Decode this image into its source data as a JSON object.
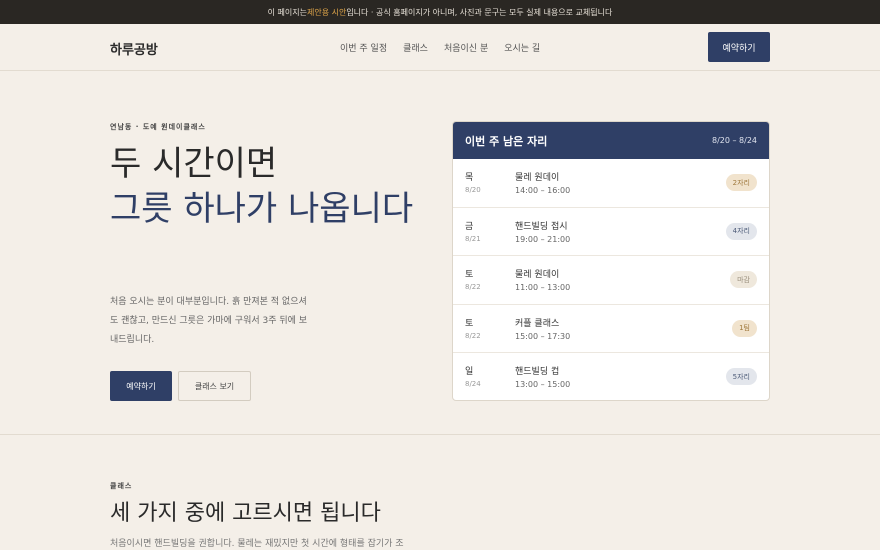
{
  "notice": {
    "before": "이 페이지는 ",
    "highlight": "제안용 시안",
    "after": "입니다 · 공식 홈페이지가 아니며, 사진과 문구는 모두 실제 내용으로 교체됩니다"
  },
  "header": {
    "logo": "하루공방",
    "nav": [
      "이번 주 일정",
      "클래스",
      "처음이신 분",
      "오시는 길"
    ],
    "cta": "예약하기"
  },
  "hero": {
    "eyebrow": "연남동 · 도예 원데이클래스",
    "title_line1": "두 시간이면",
    "title_line2": "그릇 하나가 나옵니다",
    "lede": "처음 오시는 분이 대부분입니다. 흙 만져본 적 없으셔도 괜찮고, 만드신 그릇은 가마에 구워서 3주 뒤에 보내드립니다.",
    "primary_cta": "예약하기",
    "secondary_cta": "클래스 보기"
  },
  "schedule": {
    "title": "이번 주 남은 자리",
    "range": "8/20 – 8/24",
    "rows": [
      {
        "day": "목",
        "date": "8/20",
        "class": "물레 원데이",
        "time": "14:00 – 16:00",
        "badge": "2자리"
      },
      {
        "day": "금",
        "date": "8/21",
        "class": "핸드빌딩 접시",
        "time": "19:00 – 21:00",
        "badge": "4자리"
      },
      {
        "day": "토",
        "date": "8/22",
        "class": "물레 원데이",
        "time": "11:00 – 13:00",
        "badge": "마감"
      },
      {
        "day": "토",
        "date": "8/22",
        "class": "커플 클래스",
        "time": "15:00 – 17:30",
        "badge": "1팀"
      },
      {
        "day": "일",
        "date": "8/24",
        "class": "핸드빌딩 컵",
        "time": "13:00 – 15:00",
        "badge": "5자리"
      }
    ]
  },
  "badge_colors": {
    "2자리": {
      "bg": "#f1e3cd",
      "fg": "#a07a3e"
    },
    "4자리": {
      "bg": "#e3e6ec",
      "fg": "#4f5d7a"
    },
    "마감": {
      "bg": "#efe8dc",
      "fg": "#9a8f7d"
    },
    "1팀": {
      "bg": "#f1e3cd",
      "fg": "#a07a3e"
    },
    "5자리": {
      "bg": "#e3e6ec",
      "fg": "#4f5d7a"
    }
  },
  "classes": {
    "eyebrow": "클래스",
    "title": "세 가지 중에 고르시면 됩니다",
    "sub": "처음이시면 핸드빌딩을 권합니다. 물레는 재밌지만 첫 시간에 형태를 잡기가 조"
  },
  "colors": {
    "accent": "#2f3f66",
    "background": "#f4efe8",
    "notice_bg": "#2a2723",
    "notice_highlight": "#e0a64a"
  }
}
